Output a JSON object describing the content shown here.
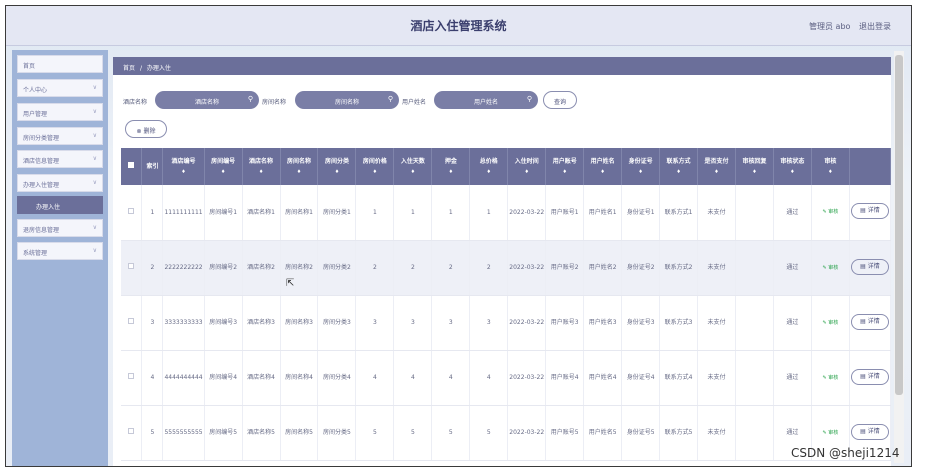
{
  "header": {
    "title": "酒店入住管理系统",
    "admin_label": "管理员 abo",
    "logout_label": "退出登录"
  },
  "sidebar": {
    "items": [
      {
        "label": "首页",
        "chevron": false
      },
      {
        "label": "个人中心",
        "chevron": true
      },
      {
        "label": "用户管理",
        "chevron": true
      },
      {
        "label": "房间分类管理",
        "chevron": true
      },
      {
        "label": "酒店信息管理",
        "chevron": true
      },
      {
        "label": "办理入住管理",
        "chevron": true
      },
      {
        "label": "办理入住",
        "active": true
      },
      {
        "label": "退房信息管理",
        "chevron": true
      },
      {
        "label": "系统管理",
        "chevron": true
      }
    ]
  },
  "breadcrumb": {
    "home": "首页",
    "separator": "/",
    "current": "办理入住"
  },
  "search": {
    "hotel_label": "酒店名称",
    "hotel_placeholder": "酒店名称",
    "room_label": "房间名称",
    "room_placeholder": "房间名称",
    "user_label": "用户姓名",
    "user_placeholder": "用户姓名",
    "query_button": "查询"
  },
  "toolbar": {
    "delete_button": "删除"
  },
  "table": {
    "headers": [
      "索引",
      "酒店编号",
      "房间编号",
      "酒店名称",
      "房间名称",
      "房间分类",
      "房间价格",
      "入住天数",
      "押金",
      "总价格",
      "入住时间",
      "用户账号",
      "用户姓名",
      "身份证号",
      "联系方式",
      "是否支付",
      "审核回复",
      "审核状态",
      "审核"
    ],
    "sortable": [
      false,
      true,
      true,
      true,
      true,
      true,
      true,
      true,
      true,
      true,
      true,
      true,
      true,
      true,
      true,
      true,
      true,
      true,
      true
    ],
    "rows": [
      [
        "1",
        "1111111111",
        "房间编号1",
        "酒店名称1",
        "房间名称1",
        "房间分类1",
        "1",
        "1",
        "1",
        "1",
        "2022-03-22",
        "用户账号1",
        "用户姓名1",
        "身份证号1",
        "联系方式1",
        "未支付",
        "",
        "通过",
        "审核"
      ],
      [
        "2",
        "2222222222",
        "房间编号2",
        "酒店名称2",
        "房间名称2",
        "房间分类2",
        "2",
        "2",
        "2",
        "2",
        "2022-03-22",
        "用户账号2",
        "用户姓名2",
        "身份证号2",
        "联系方式2",
        "未支付",
        "",
        "通过",
        "审核"
      ],
      [
        "3",
        "3333333333",
        "房间编号3",
        "酒店名称3",
        "房间名称3",
        "房间分类3",
        "3",
        "3",
        "3",
        "3",
        "2022-03-22",
        "用户账号3",
        "用户姓名3",
        "身份证号3",
        "联系方式3",
        "未支付",
        "",
        "通过",
        "审核"
      ],
      [
        "4",
        "4444444444",
        "房间编号4",
        "酒店名称4",
        "房间名称4",
        "房间分类4",
        "4",
        "4",
        "4",
        "4",
        "2022-03-22",
        "用户账号4",
        "用户姓名4",
        "身份证号4",
        "联系方式4",
        "未支付",
        "",
        "通过",
        "审核"
      ],
      [
        "5",
        "5555555555",
        "房间编号5",
        "酒店名称5",
        "房间名称5",
        "房间分类5",
        "5",
        "5",
        "5",
        "5",
        "2022-03-22",
        "用户账号5",
        "用户姓名5",
        "身份证号5",
        "联系方式5",
        "未支付",
        "",
        "通过",
        "审核"
      ]
    ],
    "detail_button": "详情",
    "highlighted_row": 1
  },
  "watermark": "CSDN @sheji1214"
}
